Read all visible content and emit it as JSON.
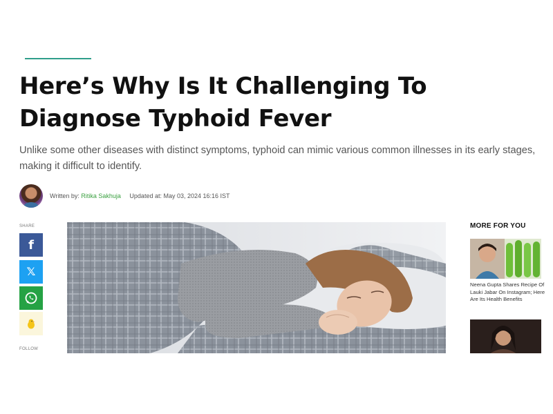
{
  "article": {
    "title": "Here’s Why Is It Challenging To Diagnose Typhoid Fever",
    "subtitle": "Unlike some other diseases with distinct symptoms, typhoid can mimic various common illnesses in its early stages, making it difficult to identify.",
    "written_by_label": "Written by:",
    "author": "Ritika Sakhuja",
    "updated_label": "Updated at:",
    "updated_at": "May 03, 2024 16:16 IST"
  },
  "share": {
    "label": "SHARE",
    "follow_label": "FOLLOW",
    "buttons": [
      {
        "name": "facebook",
        "glyph": "f",
        "color": "#3b5998"
      },
      {
        "name": "x",
        "glyph": "𝕏",
        "color": "#1da1f2"
      },
      {
        "name": "whatsapp",
        "color": "#25a244"
      },
      {
        "name": "koo",
        "color": "#fbf6dc"
      }
    ]
  },
  "sidebar": {
    "heading": "MORE FOR YOU",
    "items": [
      {
        "caption": "Neena Gupta Shares Recipe Of Lauki Jabar On Instagram; Here Are Its Health Benefits"
      }
    ]
  },
  "colors": {
    "accent": "#2f9e8a",
    "author_link": "#3aa040"
  }
}
